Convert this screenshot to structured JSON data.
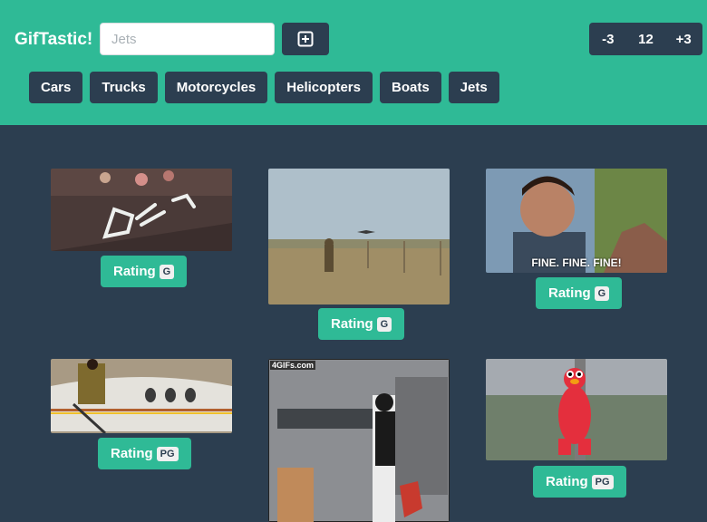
{
  "app": {
    "title": "GifTastic!"
  },
  "search": {
    "value": "",
    "placeholder": "Jets"
  },
  "pager": {
    "prev": "-3",
    "count": "12",
    "next": "+3"
  },
  "topics": [
    "Cars",
    "Trucks",
    "Motorcycles",
    "Helicopters",
    "Boats",
    "Jets"
  ],
  "gifs": [
    {
      "caption": "",
      "rating_label": "Rating",
      "rating": "G"
    },
    {
      "caption": "",
      "rating_label": "Rating",
      "rating": "G"
    },
    {
      "caption": "FINE. FINE. FINE!",
      "rating_label": "Rating",
      "rating": "G"
    },
    {
      "caption": "",
      "rating_label": "Rating",
      "rating": "PG"
    },
    {
      "caption": "4GIFs.com",
      "rating_label": "",
      "rating": ""
    },
    {
      "caption": "",
      "rating_label": "Rating",
      "rating": "PG"
    }
  ],
  "colors": {
    "navbar": "#2fba96",
    "background": "#2c3e50",
    "button": "#2c3e50"
  }
}
